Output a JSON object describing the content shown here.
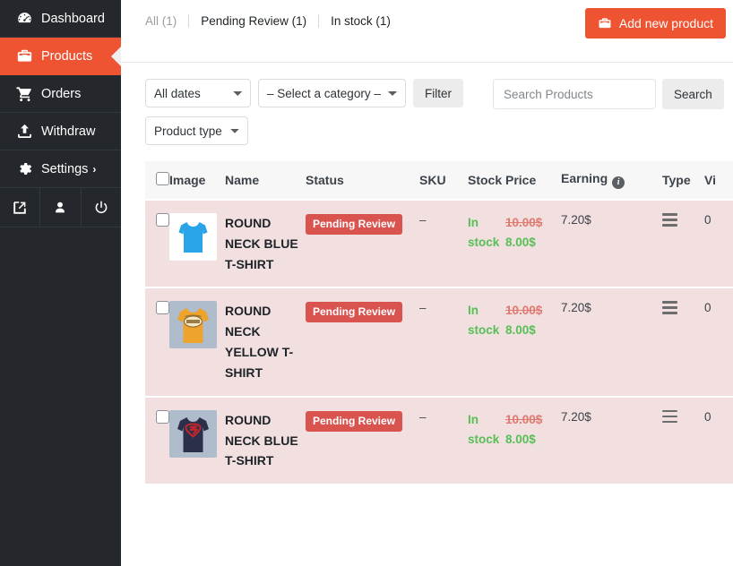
{
  "sidebar": {
    "items": [
      {
        "label": "Dashboard",
        "icon": "dashboard-icon",
        "active": false,
        "chevron": false
      },
      {
        "label": "Products",
        "icon": "toolbox-icon",
        "active": true,
        "chevron": false
      },
      {
        "label": "Orders",
        "icon": "cart-icon",
        "active": false,
        "chevron": false
      },
      {
        "label": "Withdraw",
        "icon": "upload-icon",
        "active": false,
        "chevron": false
      },
      {
        "label": "Settings",
        "icon": "gear-icon",
        "active": false,
        "chevron": true
      }
    ],
    "bottom_icons": [
      {
        "name": "external-link-icon"
      },
      {
        "name": "user-icon"
      },
      {
        "name": "power-icon"
      }
    ],
    "active_color": "#ef5432",
    "background": "#24282c"
  },
  "topbar": {
    "tabs": [
      {
        "label": "All (1)",
        "current": true
      },
      {
        "label": "Pending Review (1)",
        "current": false
      },
      {
        "label": "In stock (1)",
        "current": false
      }
    ],
    "add_button": {
      "label": "Add new product",
      "icon": "toolbox-icon",
      "color": "#ef5432"
    }
  },
  "filters": {
    "date_select": {
      "value": "All dates",
      "options": [
        "All dates"
      ]
    },
    "category_select": {
      "value": "– Select a category –",
      "options": [
        "– Select a category –"
      ]
    },
    "filter_button": "Filter",
    "product_type_select": {
      "value": "Product type",
      "options": [
        "Product type"
      ]
    },
    "search": {
      "value": "",
      "placeholder": "Search Products",
      "button_label": "Search"
    }
  },
  "table": {
    "columns": [
      {
        "key": "cb",
        "label": "",
        "name": "select-all-column"
      },
      {
        "key": "image",
        "label": "Image",
        "name": "image-column"
      },
      {
        "key": "name",
        "label": "Name",
        "name": "name-column"
      },
      {
        "key": "status",
        "label": "Status",
        "name": "status-column"
      },
      {
        "key": "sku",
        "label": "SKU",
        "name": "sku-column"
      },
      {
        "key": "stock",
        "label": "Stock",
        "name": "stock-column"
      },
      {
        "key": "price",
        "label": "Price",
        "name": "price-column"
      },
      {
        "key": "earning",
        "label": "Earning",
        "name": "earning-column",
        "info_icon": true
      },
      {
        "key": "type",
        "label": "Type",
        "name": "type-column"
      },
      {
        "key": "views",
        "label": "Vi",
        "name": "views-column"
      }
    ],
    "rows": [
      {
        "checked": false,
        "thumbnail": "blue-tshirt-thumbnail",
        "name": "ROUND NECK BLUE T-SHIRT",
        "status": "Pending Review",
        "sku": "–",
        "stock": "In stock",
        "price_old": "10.00$",
        "price_new": "8.00$",
        "earning": "7.20$",
        "type": "hamburger-icon",
        "views": "0"
      },
      {
        "checked": false,
        "thumbnail": "yellow-tshirt-thumbnail",
        "name": "ROUND NECK YELLOW T-SHIRT",
        "status": "Pending Review",
        "sku": "–",
        "stock": "In stock",
        "price_old": "10.00$",
        "price_new": "8.00$",
        "earning": "7.20$",
        "type": "hamburger-icon",
        "views": "0"
      },
      {
        "checked": false,
        "thumbnail": "navy-superman-tshirt-thumbnail",
        "name": "ROUND NECK BLUE T-SHIRT",
        "status": "Pending Review",
        "sku": "–",
        "stock": "In stock",
        "price_old": "10.00$",
        "price_new": "8.00$",
        "earning": "7.20$",
        "type": "hamburger-icon",
        "views": "0"
      }
    ],
    "row_background": "#f2dfe0",
    "badge_color": "#d9534f",
    "stock_color": "#56c057",
    "price_old_color": "#e07a70"
  }
}
